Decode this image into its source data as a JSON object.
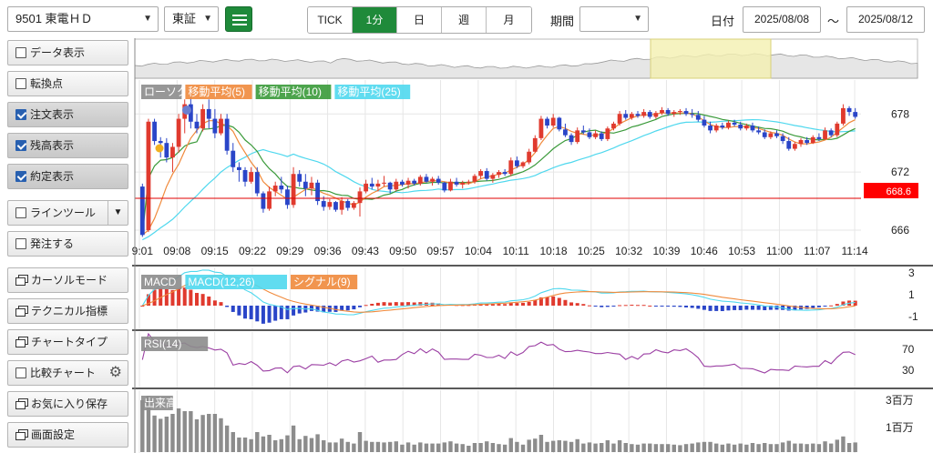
{
  "topbar": {
    "symbol": "9501 東電ＨＤ",
    "market": "東証",
    "tabs": [
      {
        "label": "TICK",
        "active": false
      },
      {
        "label": "1分",
        "active": true
      },
      {
        "label": "日",
        "active": false
      },
      {
        "label": "週",
        "active": false
      },
      {
        "label": "月",
        "active": false
      }
    ],
    "period_label": "期間",
    "period_value": "",
    "date_label": "日付",
    "date_from": "2025/08/08",
    "date_sep": "～",
    "date_to": "2025/08/12"
  },
  "sidebar": {
    "items": [
      {
        "label": "データ表示",
        "type": "checkbox",
        "checked": false
      },
      {
        "label": "転換点",
        "type": "checkbox",
        "checked": false
      },
      {
        "label": "注文表示",
        "type": "checkbox",
        "checked": true
      },
      {
        "label": "残高表示",
        "type": "checkbox",
        "checked": true
      },
      {
        "label": "約定表示",
        "type": "checkbox",
        "checked": true
      },
      {
        "label": "ラインツール",
        "type": "checkbox-dropdown",
        "checked": false
      },
      {
        "label": "発注する",
        "type": "checkbox",
        "checked": false
      },
      {
        "label": "カーソルモード",
        "type": "window"
      },
      {
        "label": "テクニカル指標",
        "type": "window"
      },
      {
        "label": "チャートタイプ",
        "type": "window"
      },
      {
        "label": "比較チャート",
        "type": "checkbox-gear",
        "checked": false
      },
      {
        "label": "お気に入り保存",
        "type": "window"
      },
      {
        "label": "画面設定",
        "type": "window"
      }
    ]
  },
  "colors": {
    "up": "#e03a2e",
    "down": "#2a45c8",
    "ma5": "#f08a3c",
    "ma10": "#3a9a3a",
    "ma25": "#4fd8ee",
    "accent": "#1f8a3a",
    "price_line": "#e00000"
  },
  "chart_data": {
    "type": "candlestick",
    "x_ticks": [
      "09:01",
      "09:08",
      "09:15",
      "09:22",
      "09:29",
      "09:36",
      "09:43",
      "09:50",
      "09:57",
      "10:04",
      "10:11",
      "10:18",
      "10:25",
      "10:32",
      "10:39",
      "10:46",
      "10:53",
      "11:00",
      "11:07",
      "11:14"
    ],
    "main": {
      "legend": [
        "ローソク",
        "移動平均(5)",
        "移動平均(10)",
        "移動平均(25)"
      ],
      "y_ticks": [
        678,
        672,
        666
      ],
      "ylim": [
        664.4,
        681.5
      ],
      "current_price": "668.6",
      "ohlc": [
        [
          670.5,
          670.8,
          665.3,
          665.5
        ],
        [
          666.0,
          677.5,
          665.8,
          677.2
        ],
        [
          677.2,
          677.5,
          674.8,
          675.2
        ],
        [
          675.2,
          675.6,
          673.5,
          675.0
        ],
        [
          675.0,
          675.5,
          673.0,
          673.5
        ],
        [
          673.5,
          675.0,
          672.0,
          674.6
        ],
        [
          674.6,
          678.0,
          674.0,
          677.5
        ],
        [
          677.5,
          679.5,
          676.0,
          679.0
        ],
        [
          679.0,
          680.0,
          676.5,
          677.2
        ],
        [
          677.2,
          678.0,
          676.0,
          676.5
        ],
        [
          676.5,
          679.0,
          676.2,
          678.5
        ],
        [
          678.5,
          679.5,
          676.5,
          677.5
        ],
        [
          677.5,
          678.5,
          675.5,
          676.0
        ],
        [
          676.0,
          678.0,
          675.8,
          677.5
        ],
        [
          677.5,
          678.0,
          673.8,
          674.2
        ],
        [
          674.2,
          675.0,
          672.0,
          672.5
        ],
        [
          672.5,
          673.0,
          671.0,
          672.2
        ],
        [
          672.2,
          672.5,
          670.5,
          671.0
        ],
        [
          671.0,
          672.5,
          670.8,
          672.0
        ],
        [
          672.0,
          672.5,
          669.5,
          669.8
        ],
        [
          669.8,
          670.0,
          667.8,
          668.2
        ],
        [
          668.2,
          670.5,
          668.0,
          670.0
        ],
        [
          670.0,
          671.0,
          669.5,
          670.6
        ],
        [
          670.6,
          671.5,
          669.8,
          670.2
        ],
        [
          670.2,
          670.6,
          668.2,
          668.6
        ],
        [
          668.6,
          672.5,
          668.3,
          671.8
        ],
        [
          671.8,
          672.2,
          670.5,
          671.0
        ],
        [
          671.0,
          671.8,
          669.5,
          670.3
        ],
        [
          670.3,
          671.5,
          669.6,
          670.9
        ],
        [
          670.9,
          671.2,
          668.6,
          669.0
        ],
        [
          669.0,
          669.5,
          668.0,
          668.4
        ],
        [
          668.4,
          669.2,
          668.1,
          668.9
        ],
        [
          668.9,
          669.0,
          667.9,
          668.1
        ],
        [
          668.1,
          669.4,
          667.6,
          669.0
        ],
        [
          669.0,
          669.2,
          668.0,
          668.3
        ],
        [
          668.3,
          669.0,
          668.1,
          668.8
        ],
        [
          668.8,
          670.4,
          667.4,
          670.0
        ],
        [
          670.0,
          671.2,
          669.8,
          670.8
        ],
        [
          670.8,
          671.4,
          670.2,
          670.5
        ],
        [
          670.5,
          671.2,
          670.0,
          670.8
        ],
        [
          670.8,
          671.6,
          670.5,
          670.9
        ],
        [
          670.9,
          671.0,
          669.8,
          670.2
        ],
        [
          670.2,
          671.3,
          670.0,
          671.0
        ],
        [
          671.0,
          671.2,
          670.5,
          670.7
        ],
        [
          670.7,
          671.4,
          670.3,
          671.1
        ],
        [
          671.1,
          671.3,
          670.6,
          670.8
        ],
        [
          670.8,
          671.7,
          670.6,
          671.5
        ],
        [
          671.5,
          671.8,
          670.9,
          671.0
        ],
        [
          671.0,
          671.5,
          670.6,
          671.3
        ],
        [
          671.3,
          671.6,
          670.7,
          670.9
        ],
        [
          670.9,
          671.0,
          669.9,
          670.1
        ],
        [
          670.1,
          671.3,
          670.0,
          671.0
        ],
        [
          671.0,
          671.4,
          670.5,
          670.7
        ],
        [
          670.7,
          671.1,
          670.3,
          670.9
        ],
        [
          670.9,
          671.2,
          670.7,
          671.0
        ],
        [
          671.0,
          671.8,
          670.8,
          671.6
        ],
        [
          671.6,
          672.3,
          671.3,
          672.1
        ],
        [
          672.1,
          672.4,
          671.1,
          671.3
        ],
        [
          671.3,
          671.9,
          670.9,
          671.7
        ],
        [
          671.7,
          672.2,
          671.4,
          672.0
        ],
        [
          672.0,
          672.3,
          671.6,
          671.8
        ],
        [
          671.8,
          673.5,
          671.6,
          673.2
        ],
        [
          673.2,
          673.6,
          672.4,
          672.6
        ],
        [
          672.6,
          673.1,
          672.4,
          673.0
        ],
        [
          673.0,
          674.4,
          672.8,
          674.1
        ],
        [
          674.1,
          675.8,
          674.0,
          675.5
        ],
        [
          675.5,
          677.8,
          675.3,
          677.5
        ],
        [
          677.5,
          677.7,
          676.5,
          676.8
        ],
        [
          676.8,
          678.0,
          676.6,
          677.6
        ],
        [
          677.6,
          677.7,
          676.2,
          676.4
        ],
        [
          676.4,
          677.0,
          675.6,
          675.8
        ],
        [
          675.8,
          676.0,
          674.8,
          675.1
        ],
        [
          675.1,
          676.6,
          674.9,
          676.3
        ],
        [
          676.3,
          676.8,
          675.9,
          676.1
        ],
        [
          676.1,
          676.5,
          675.4,
          675.6
        ],
        [
          675.6,
          676.3,
          675.4,
          676.0
        ],
        [
          676.0,
          676.2,
          675.2,
          675.4
        ],
        [
          675.4,
          676.7,
          675.2,
          676.5
        ],
        [
          676.5,
          677.2,
          676.3,
          677.0
        ],
        [
          677.0,
          678.3,
          676.8,
          678.0
        ],
        [
          678.0,
          678.4,
          677.4,
          677.6
        ],
        [
          677.6,
          678.2,
          677.4,
          678.0
        ],
        [
          678.0,
          678.3,
          677.6,
          677.8
        ],
        [
          677.8,
          678.5,
          677.6,
          678.2
        ],
        [
          678.2,
          678.4,
          677.5,
          677.7
        ],
        [
          677.7,
          678.3,
          677.5,
          678.1
        ],
        [
          678.1,
          678.7,
          677.9,
          678.4
        ],
        [
          678.4,
          678.6,
          677.8,
          678.0
        ],
        [
          678.0,
          678.4,
          677.7,
          678.2
        ],
        [
          678.2,
          678.5,
          677.9,
          678.3
        ],
        [
          678.3,
          678.6,
          677.8,
          678.0
        ],
        [
          678.0,
          678.5,
          677.6,
          677.9
        ],
        [
          677.9,
          678.3,
          677.2,
          677.4
        ],
        [
          677.4,
          677.8,
          676.6,
          676.8
        ],
        [
          676.8,
          677.2,
          676.0,
          676.3
        ],
        [
          676.3,
          677.0,
          676.1,
          676.8
        ],
        [
          676.8,
          677.1,
          676.4,
          676.6
        ],
        [
          676.6,
          677.3,
          676.4,
          677.1
        ],
        [
          677.1,
          677.4,
          676.7,
          676.9
        ],
        [
          676.9,
          677.2,
          676.3,
          676.5
        ],
        [
          676.5,
          677.0,
          676.3,
          676.8
        ],
        [
          676.8,
          677.1,
          676.1,
          676.3
        ],
        [
          676.3,
          676.7,
          675.9,
          676.1
        ],
        [
          676.1,
          676.4,
          675.4,
          675.6
        ],
        [
          675.6,
          676.2,
          675.4,
          676.0
        ],
        [
          676.0,
          676.3,
          675.5,
          675.7
        ],
        [
          675.7,
          676.0,
          674.9,
          675.2
        ],
        [
          675.2,
          675.6,
          674.2,
          674.4
        ],
        [
          674.4,
          675.1,
          674.2,
          674.9
        ],
        [
          674.9,
          675.5,
          674.6,
          675.3
        ],
        [
          675.3,
          675.6,
          674.8,
          675.0
        ],
        [
          675.0,
          675.8,
          674.9,
          675.6
        ],
        [
          675.6,
          676.0,
          675.2,
          675.4
        ],
        [
          675.4,
          676.6,
          675.3,
          676.3
        ],
        [
          676.3,
          676.5,
          675.6,
          675.8
        ],
        [
          675.8,
          677.2,
          675.6,
          677.0
        ],
        [
          677.0,
          679.0,
          676.8,
          678.6
        ],
        [
          678.6,
          678.8,
          677.8,
          678.2
        ],
        [
          678.2,
          678.6,
          677.5,
          677.7
        ]
      ],
      "ma5": [
        665.5,
        666.0,
        667.2,
        668.8,
        670.5,
        671.8,
        672.8,
        674.2,
        675.5,
        676.3,
        677.0,
        677.3,
        677.3,
        677.0,
        676.8,
        676.2,
        675.0,
        674.0,
        673.0,
        672.2,
        671.0,
        670.4,
        670.0,
        669.6,
        669.2,
        669.4,
        669.8,
        670.2,
        670.4,
        670.1,
        669.8,
        669.6,
        669.3,
        669.0,
        668.8,
        668.6,
        668.9,
        669.4,
        669.8,
        670.1,
        670.5,
        670.6,
        670.6,
        670.7,
        670.8,
        670.8,
        670.9,
        671.0,
        671.1,
        671.1,
        671.0,
        670.9,
        670.8,
        670.8,
        670.8,
        671.0,
        671.3,
        671.5,
        671.6,
        671.8,
        671.9,
        672.2,
        672.5,
        672.8,
        673.3,
        674.0,
        675.0,
        675.8,
        676.5,
        676.7,
        676.5,
        676.2,
        676.0,
        675.9,
        675.8,
        675.8,
        675.9,
        676.1,
        676.5,
        677.0,
        677.3,
        677.6,
        677.8,
        677.9,
        677.9,
        678.0,
        678.1,
        678.1,
        678.1,
        678.1,
        678.1,
        678.0,
        677.7,
        677.3,
        676.9,
        676.7,
        676.6,
        676.6,
        676.7,
        676.7,
        676.7,
        676.6,
        676.5,
        676.3,
        676.1,
        676.0,
        675.8,
        675.4,
        675.1,
        674.9,
        674.9,
        675.0,
        675.1,
        675.3,
        675.6,
        676.1,
        676.6,
        677.1,
        677.4
      ]
    },
    "macd": {
      "legend": [
        "MACD",
        "MACD(12,26)",
        "シグナル(9)"
      ],
      "y_ticks": [
        3,
        1,
        -1
      ],
      "ylim": [
        -2,
        3.5
      ]
    },
    "rsi": {
      "legend": [
        "RSI(14)"
      ],
      "y_ticks": [
        70,
        30
      ],
      "ylim": [
        0,
        100
      ]
    },
    "volume": {
      "legend": [
        "出来高"
      ],
      "y_ticks": [
        "3百万",
        "1百万"
      ]
    }
  }
}
